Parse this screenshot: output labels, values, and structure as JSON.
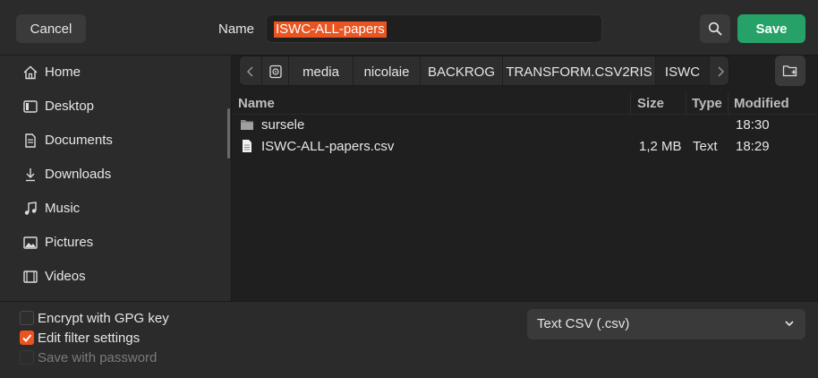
{
  "header": {
    "cancel_label": "Cancel",
    "name_label": "Name",
    "filename_value": "ISWC-ALL-papers",
    "save_label": "Save"
  },
  "sidebar": {
    "items": [
      {
        "label": "Home",
        "icon": "home-icon"
      },
      {
        "label": "Desktop",
        "icon": "desktop-icon"
      },
      {
        "label": "Documents",
        "icon": "documents-icon"
      },
      {
        "label": "Downloads",
        "icon": "downloads-icon"
      },
      {
        "label": "Music",
        "icon": "music-icon"
      },
      {
        "label": "Pictures",
        "icon": "pictures-icon"
      },
      {
        "label": "Videos",
        "icon": "videos-icon"
      }
    ]
  },
  "pathbar": {
    "crumbs": [
      "media",
      "nicolaie",
      "BACKROG",
      "TRANSFORM.CSV2RIS",
      "ISWC"
    ],
    "active_crumb": "ISWC"
  },
  "filelist": {
    "columns": {
      "name": "Name",
      "size": "Size",
      "type": "Type",
      "modified": "Modified"
    },
    "rows": [
      {
        "name": "sursele",
        "size": "",
        "type": "",
        "modified": "18:30",
        "icon": "folder-icon"
      },
      {
        "name": "ISWC-ALL-papers.csv",
        "size": "1,2 MB",
        "type": "Text",
        "modified": "18:29",
        "icon": "text-file-icon"
      }
    ]
  },
  "footer": {
    "options": [
      {
        "label": "Encrypt with GPG key",
        "checked": false,
        "enabled": true
      },
      {
        "label": "Edit filter settings",
        "checked": true,
        "enabled": true
      },
      {
        "label": "Save with password",
        "checked": false,
        "enabled": false
      }
    ],
    "filter_selected": "Text CSV (.csv)"
  },
  "colors": {
    "accent": "#e95420",
    "save_green": "#26a269",
    "background": "#1f1f1f",
    "panel": "#2b2b2b"
  }
}
